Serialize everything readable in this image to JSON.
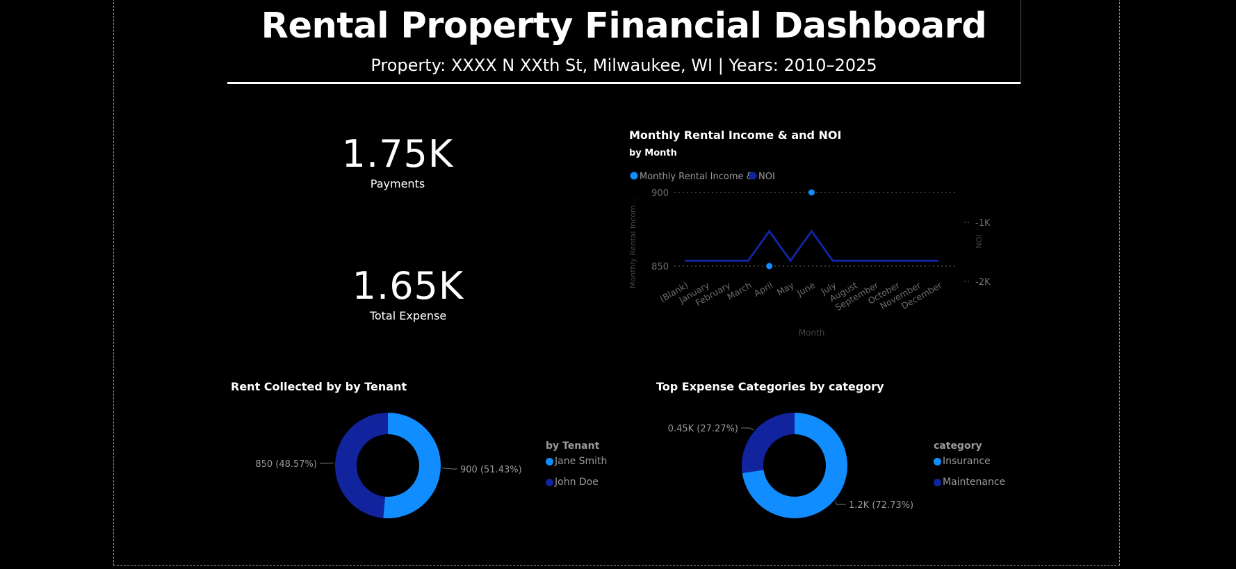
{
  "header": {
    "title": "Rental Property Financial Dashboard",
    "subtitle": "Property: XXXX N XXth St, Milwaukee, WI | Years: 2010–2025"
  },
  "kpis": {
    "payments": {
      "value": "1.75K",
      "label": "Payments"
    },
    "total_expense": {
      "value": "1.65K",
      "label": "Total Expense"
    }
  },
  "colors": {
    "light_blue": "#118DFF",
    "dark_blue": "#12239E",
    "axis_text": "#6e6e6e",
    "grid": "#6e6e6e"
  },
  "chart_data": [
    {
      "type": "line",
      "title": "Monthly Rental Income & and NOI",
      "subtitle": "by Month",
      "legend": [
        "Monthly Rental Income &",
        "NOI"
      ],
      "legend_position": "top-left",
      "xlabel": "Month",
      "ylabel": "Monthly Rental Incom...",
      "y2label": "NOI",
      "categories": [
        "(Blank)",
        "January",
        "February",
        "March",
        "April",
        "May",
        "June",
        "July",
        "August",
        "September",
        "October",
        "November",
        "December"
      ],
      "ylim": [
        850,
        900
      ],
      "yticks": [
        "900",
        "850"
      ],
      "y2lim": [
        -1000,
        -2000
      ],
      "y2ticks": [
        "-1K",
        "-2K"
      ],
      "grid": true,
      "series": [
        {
          "name": "Monthly Rental Income &",
          "axis": "left",
          "markers_only": true,
          "points": [
            {
              "x": "April",
              "y": 850
            },
            {
              "x": "June",
              "y": 900
            }
          ]
        },
        {
          "name": "NOI",
          "axis": "right",
          "values": [
            -1650,
            -1650,
            -1650,
            -1650,
            -1150,
            -1650,
            -1150,
            -1650,
            -1650,
            -1650,
            -1650,
            -1650,
            -1650
          ]
        }
      ]
    },
    {
      "type": "pie",
      "title": "Rent Collected by by Tenant",
      "legend_title": "by Tenant",
      "legend_position": "right",
      "slices": [
        {
          "name": "Jane Smith",
          "value": 900,
          "label": "900 (51.43%)"
        },
        {
          "name": "John Doe",
          "value": 850,
          "label": "850 (48.57%)"
        }
      ]
    },
    {
      "type": "pie",
      "title": "Top Expense Categories by category",
      "legend_title": "category",
      "legend_position": "right",
      "slices": [
        {
          "name": "Insurance",
          "value": 1200,
          "label": "1.2K (72.73%)"
        },
        {
          "name": "Maintenance",
          "value": 450,
          "label": "0.45K (27.27%)"
        }
      ]
    }
  ]
}
